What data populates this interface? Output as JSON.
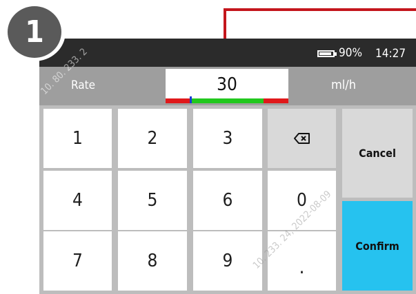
{
  "badge": {
    "number": "1"
  },
  "status": {
    "battery_percent": 90,
    "battery_text": "90%",
    "time": "14:27"
  },
  "entry": {
    "label": "Rate",
    "value": "30",
    "unit": "ml/h"
  },
  "keys": {
    "k1": "1",
    "k2": "2",
    "k3": "3",
    "k4": "4",
    "k5": "5",
    "k6": "6",
    "k7": "7",
    "k8": "8",
    "k9": "9",
    "k0": "0",
    "decimal": "."
  },
  "actions": {
    "cancel": "Cancel",
    "confirm": "Confirm"
  },
  "icons": {
    "backspace": "backspace-icon",
    "battery": "battery-icon"
  },
  "watermark": {
    "text_top": "10. 80. 233. 2",
    "text_bottom": "10. 233. 24, 2022-08-09"
  },
  "colors": {
    "accent_confirm": "#26c2ef",
    "range_low": "#e0191b",
    "range_ok": "#22c81e",
    "range_high": "#e0191b",
    "value_marker": "#1a3bd6",
    "connector": "#c4161c"
  }
}
